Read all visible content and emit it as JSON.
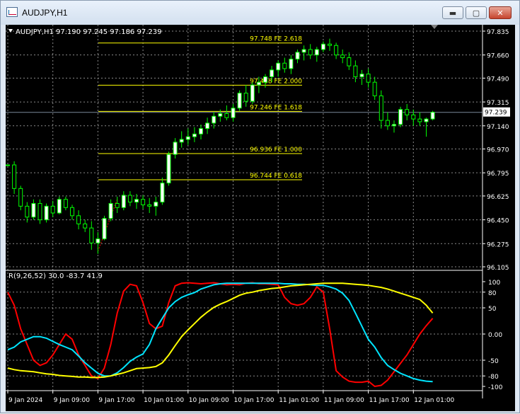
{
  "window": {
    "title": "AUDJPY,H1",
    "buttons": {
      "minimize": "▬",
      "maximize": "▢",
      "close": "✕"
    }
  },
  "chart": {
    "info_line": "AUDJPY,H1  97.190 97.245 97.186 97.239",
    "current_price_label": "97.239",
    "fib_levels": [
      {
        "label": "97.748 FE 2.618",
        "price": 97.748
      },
      {
        "label": "97.438 FE 2.000",
        "price": 97.438
      },
      {
        "label": "97.246 FE 1.618",
        "price": 97.246
      },
      {
        "label": "96.936 FE 1.000",
        "price": 96.936
      },
      {
        "label": "96.744 FE 0.618",
        "price": 96.744
      }
    ],
    "price_ticks": [
      "97.835",
      "97.660",
      "97.490",
      "97.315",
      "97.140",
      "96.970",
      "96.795",
      "96.625",
      "96.450",
      "96.275",
      "96.105"
    ],
    "indicator_label": "R(9,26,52) 30.0 -83.7 41.9",
    "indicator_ticks": [
      "100",
      "80",
      "50",
      "0.00",
      "-50",
      "-80",
      "-100"
    ],
    "time_labels": [
      "9 Jan 2024",
      "9 Jan 09:00",
      "9 Jan 17:00",
      "10 Jan 01:00",
      "10 Jan 09:00",
      "10 Jan 17:00",
      "11 Jan 01:00",
      "11 Jan 09:00",
      "11 Jan 17:00",
      "12 Jan 01:00"
    ],
    "colors": {
      "background": "#000000",
      "bull": "#ffffff",
      "bear": "#000000",
      "wick": "#00ff00",
      "fib": "#ffff00",
      "red": "#ff0000",
      "cyan": "#00e5ff",
      "yellow": "#ffff00",
      "grid": "#8a8a8a"
    }
  },
  "chart_data": {
    "type": "candlestick",
    "price_range": [
      96.105,
      97.835
    ],
    "candles": [
      [
        96.853,
        96.853,
        96.853,
        96.853
      ],
      [
        96.853,
        96.88,
        96.64,
        96.68
      ],
      [
        96.68,
        96.7,
        96.52,
        96.55
      ],
      [
        96.55,
        96.58,
        96.43,
        96.47
      ],
      [
        96.47,
        96.6,
        96.45,
        96.57
      ],
      [
        96.57,
        96.6,
        96.42,
        96.45
      ],
      [
        96.45,
        96.57,
        96.43,
        96.55
      ],
      [
        96.55,
        96.59,
        96.47,
        96.5
      ],
      [
        96.5,
        96.62,
        96.49,
        96.6
      ],
      [
        96.6,
        96.62,
        96.52,
        96.54
      ],
      [
        96.54,
        96.56,
        96.45,
        96.48
      ],
      [
        96.48,
        96.52,
        96.38,
        96.42
      ],
      [
        96.42,
        96.45,
        96.36,
        96.39
      ],
      [
        96.39,
        96.44,
        96.23,
        96.28
      ],
      [
        96.28,
        96.36,
        96.2,
        96.31
      ],
      [
        96.31,
        96.48,
        96.3,
        96.46
      ],
      [
        96.46,
        96.6,
        96.44,
        96.57
      ],
      [
        96.57,
        96.62,
        96.5,
        96.54
      ],
      [
        96.54,
        96.66,
        96.52,
        96.63
      ],
      [
        96.63,
        96.66,
        96.55,
        96.58
      ],
      [
        96.58,
        96.64,
        96.53,
        96.6
      ],
      [
        96.6,
        96.63,
        96.53,
        96.56
      ],
      [
        96.56,
        96.61,
        96.5,
        96.55
      ],
      [
        96.55,
        96.62,
        96.48,
        96.58
      ],
      [
        96.58,
        96.76,
        96.56,
        96.72
      ],
      [
        96.72,
        96.95,
        96.7,
        96.93
      ],
      [
        96.93,
        97.05,
        96.9,
        97.02
      ],
      [
        97.02,
        97.1,
        96.98,
        97.04
      ],
      [
        97.04,
        97.12,
        97.0,
        97.06
      ],
      [
        97.06,
        97.13,
        97.02,
        97.08
      ],
      [
        97.08,
        97.15,
        97.04,
        97.12
      ],
      [
        97.12,
        97.2,
        97.08,
        97.16
      ],
      [
        97.16,
        97.24,
        97.12,
        97.21
      ],
      [
        97.21,
        97.26,
        97.17,
        97.23
      ],
      [
        97.23,
        97.29,
        97.18,
        97.2
      ],
      [
        97.2,
        97.3,
        97.17,
        97.27
      ],
      [
        97.27,
        97.4,
        97.25,
        97.38
      ],
      [
        97.38,
        97.44,
        97.28,
        97.32
      ],
      [
        97.32,
        97.46,
        97.3,
        97.44
      ],
      [
        97.44,
        97.5,
        97.38,
        97.46
      ],
      [
        97.46,
        97.52,
        97.42,
        97.5
      ],
      [
        97.5,
        97.58,
        97.46,
        97.55
      ],
      [
        97.55,
        97.62,
        97.5,
        97.6
      ],
      [
        97.6,
        97.64,
        97.53,
        97.56
      ],
      [
        97.56,
        97.66,
        97.52,
        97.63
      ],
      [
        97.63,
        97.7,
        97.6,
        97.68
      ],
      [
        97.68,
        97.73,
        97.62,
        97.7
      ],
      [
        97.7,
        97.74,
        97.63,
        97.66
      ],
      [
        97.66,
        97.72,
        97.61,
        97.7
      ],
      [
        97.7,
        97.76,
        97.68,
        97.74
      ],
      [
        97.74,
        97.78,
        97.69,
        97.73
      ],
      [
        97.73,
        97.75,
        97.63,
        97.66
      ],
      [
        97.66,
        97.7,
        97.6,
        97.64
      ],
      [
        97.64,
        97.68,
        97.55,
        97.58
      ],
      [
        97.58,
        97.62,
        97.46,
        97.5
      ],
      [
        97.5,
        97.55,
        97.44,
        97.52
      ],
      [
        97.52,
        97.56,
        97.42,
        97.46
      ],
      [
        97.46,
        97.5,
        97.33,
        97.36
      ],
      [
        97.36,
        97.4,
        97.12,
        97.18
      ],
      [
        97.18,
        97.24,
        97.11,
        97.14
      ],
      [
        97.14,
        97.18,
        97.09,
        97.15
      ],
      [
        97.15,
        97.28,
        97.13,
        97.26
      ],
      [
        97.26,
        97.3,
        97.18,
        97.22
      ],
      [
        97.22,
        97.26,
        97.14,
        97.19
      ],
      [
        97.19,
        97.24,
        97.14,
        97.17
      ],
      [
        97.17,
        97.2,
        97.06,
        97.19
      ],
      [
        97.19,
        97.25,
        97.18,
        97.24
      ]
    ],
    "rsi_series": [
      {
        "name": "9",
        "color": "red",
        "values": [
          80,
          55,
          10,
          -20,
          -50,
          -60,
          -55,
          -40,
          -20,
          0,
          -10,
          -40,
          -60,
          -80,
          -85,
          -65,
          -20,
          40,
          82,
          95,
          92,
          60,
          20,
          10,
          15,
          60,
          92,
          97,
          98,
          97,
          96,
          97,
          98,
          96,
          94,
          95,
          94,
          97,
          98,
          96,
          96,
          95,
          94,
          70,
          58,
          55,
          58,
          70,
          90,
          80,
          10,
          -70,
          -82,
          -90,
          -92,
          -92,
          -90,
          -100,
          -98,
          -88,
          -72,
          -56,
          -40,
          -20,
          0,
          16,
          30
        ]
      },
      {
        "name": "26",
        "color": "cyan",
        "values": [
          -30,
          -25,
          -15,
          -10,
          -5,
          -5,
          -8,
          -14,
          -20,
          -25,
          -30,
          -42,
          -55,
          -65,
          -75,
          -80,
          -80,
          -74,
          -64,
          -52,
          -44,
          -38,
          -20,
          10,
          30,
          50,
          62,
          70,
          75,
          79,
          86,
          90,
          94,
          96,
          97,
          97,
          97,
          97,
          97,
          97,
          97,
          97,
          97,
          96,
          96,
          95,
          95,
          94,
          93,
          93,
          90,
          86,
          78,
          64,
          40,
          15,
          -10,
          -25,
          -45,
          -60,
          -68,
          -75,
          -80,
          -85,
          -88,
          -90,
          -91
        ]
      },
      {
        "name": "52",
        "color": "yellow",
        "values": [
          -65,
          -68,
          -70,
          -71,
          -72,
          -74,
          -76,
          -77,
          -79,
          -80,
          -81,
          -82,
          -82,
          -83,
          -83,
          -82,
          -80,
          -77,
          -74,
          -70,
          -66,
          -65,
          -64,
          -62,
          -55,
          -40,
          -22,
          -5,
          8,
          20,
          32,
          42,
          51,
          57,
          62,
          68,
          74,
          78,
          80,
          83,
          85,
          87,
          88,
          90,
          92,
          93,
          94,
          95,
          96,
          97,
          97,
          97,
          97,
          96,
          95,
          94,
          93,
          91,
          89,
          86,
          82,
          78,
          74,
          70,
          66,
          55,
          40
        ]
      }
    ]
  }
}
